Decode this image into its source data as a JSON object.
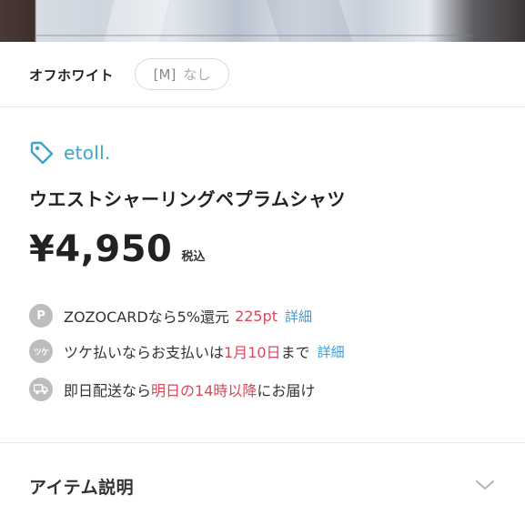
{
  "variant": {
    "color": "オフホワイト",
    "size_code": "[M]",
    "size_status": "なし"
  },
  "brand": {
    "name": "etoll.",
    "icon": "tag-icon",
    "color": "#3aa6c8"
  },
  "item": {
    "name": "ウエストシャーリングペプラムシャツ",
    "price": "¥4,950",
    "tax_label": "税込"
  },
  "perks": {
    "zozocard": {
      "icon": "point-icon",
      "badge": "P",
      "text": "ZOZOCARDなら5%還元",
      "highlight": "225pt",
      "link": "詳細"
    },
    "tsuke": {
      "icon": "tsuke-icon",
      "badge": "ツケ",
      "text_before": "ツケ払いならお支払いは",
      "highlight": "1月10日",
      "text_after": "まで",
      "link": "詳細"
    },
    "delivery": {
      "icon": "truck-icon",
      "text_before": "即日配送なら",
      "highlight": "明日の14時以降",
      "text_after": "にお届け"
    }
  },
  "accordion": {
    "title": "アイテム説明",
    "icon": "chevron-down-icon"
  },
  "colors": {
    "accent_red": "#d9475a",
    "link_blue": "#3a9bd1"
  }
}
